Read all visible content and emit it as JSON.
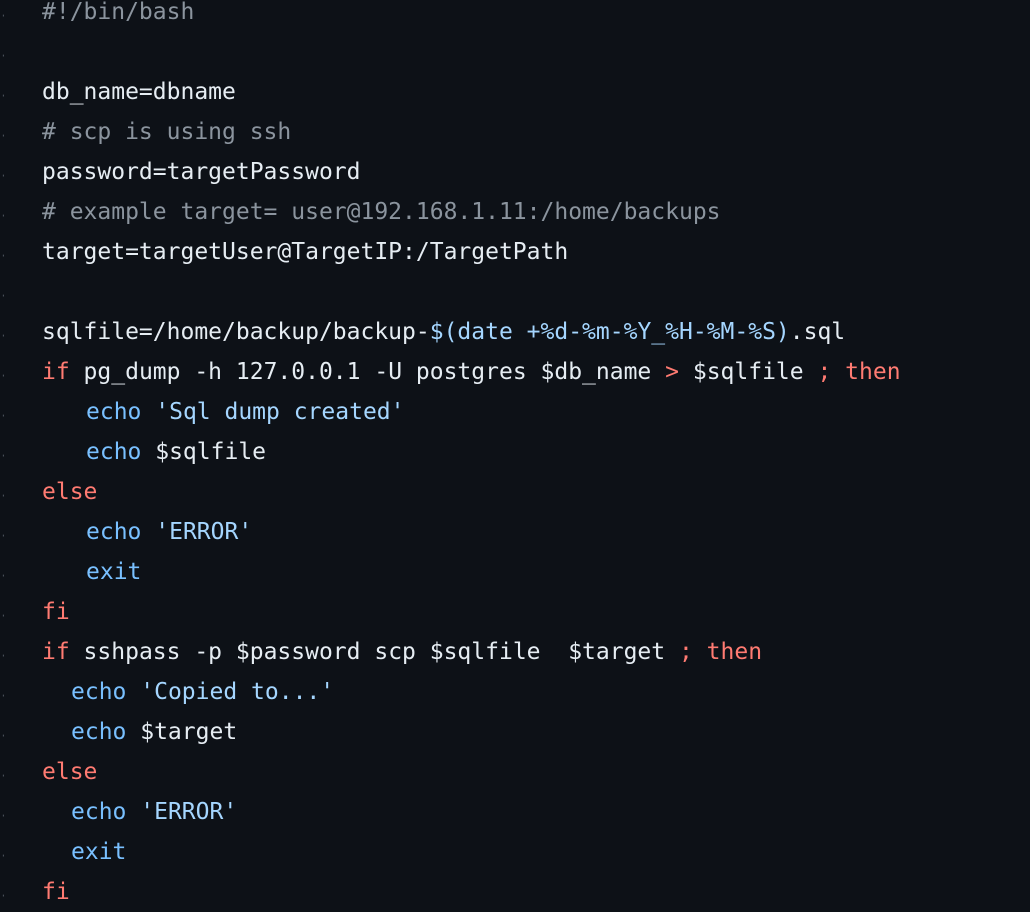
{
  "colors": {
    "background": "#0d1117",
    "plain": "#e6edf3",
    "comment": "#8b949e",
    "keyword": "#ff7b72",
    "builtin": "#79c0ff",
    "string": "#a5d6ff"
  },
  "code": {
    "lines": [
      [
        {
          "t": "comment",
          "v": "#!/bin/bash"
        }
      ],
      [],
      [
        {
          "t": "plain",
          "v": "db_name=dbname"
        }
      ],
      [
        {
          "t": "comment",
          "v": "# scp is using ssh"
        }
      ],
      [
        {
          "t": "plain",
          "v": "password=targetPassword"
        }
      ],
      [
        {
          "t": "comment",
          "v": "# example target= user@192.168.1.11:/home/backups"
        }
      ],
      [
        {
          "t": "plain",
          "v": "target=targetUser@TargetIP:/TargetPath"
        }
      ],
      [],
      [
        {
          "t": "plain",
          "v": "sqlfile=/home/backup/backup-"
        },
        {
          "t": "subst",
          "v": "$(date +%d-%m-%Y_%H-%M-%S)"
        },
        {
          "t": "plain",
          "v": ".sql"
        }
      ],
      [
        {
          "t": "keyword",
          "v": "if"
        },
        {
          "t": "plain",
          "v": " pg_dump -h 127.0.0.1 -U postgres $db_name "
        },
        {
          "t": "keyword",
          "v": ">"
        },
        {
          "t": "plain",
          "v": " $sqlfile "
        },
        {
          "t": "keyword",
          "v": "; then"
        }
      ],
      [
        {
          "t": "builtin",
          "v": "echo"
        },
        {
          "t": "plain",
          "v": " "
        },
        {
          "t": "string",
          "v": "'Sql dump created'"
        }
      ],
      [
        {
          "t": "builtin",
          "v": "echo"
        },
        {
          "t": "plain",
          "v": " $sqlfile"
        }
      ],
      [
        {
          "t": "keyword",
          "v": "else"
        }
      ],
      [
        {
          "t": "builtin",
          "v": "echo"
        },
        {
          "t": "plain",
          "v": " "
        },
        {
          "t": "string",
          "v": "'ERROR'"
        }
      ],
      [
        {
          "t": "builtin",
          "v": "exit"
        }
      ],
      [
        {
          "t": "keyword",
          "v": "fi"
        }
      ],
      [
        {
          "t": "keyword",
          "v": "if"
        },
        {
          "t": "plain",
          "v": " sshpass -p $password scp $sqlfile  $target "
        },
        {
          "t": "keyword",
          "v": "; then"
        }
      ],
      [
        {
          "t": "builtin",
          "v": "echo"
        },
        {
          "t": "plain",
          "v": " "
        },
        {
          "t": "string",
          "v": "'Copied to...'"
        }
      ],
      [
        {
          "t": "builtin",
          "v": "echo"
        },
        {
          "t": "plain",
          "v": " $target"
        }
      ],
      [
        {
          "t": "keyword",
          "v": "else"
        }
      ],
      [
        {
          "t": "builtin",
          "v": "echo"
        },
        {
          "t": "plain",
          "v": " "
        },
        {
          "t": "string",
          "v": "'ERROR'"
        }
      ],
      [
        {
          "t": "builtin",
          "v": "exit"
        }
      ],
      [
        {
          "t": "keyword",
          "v": "fi"
        }
      ]
    ]
  }
}
